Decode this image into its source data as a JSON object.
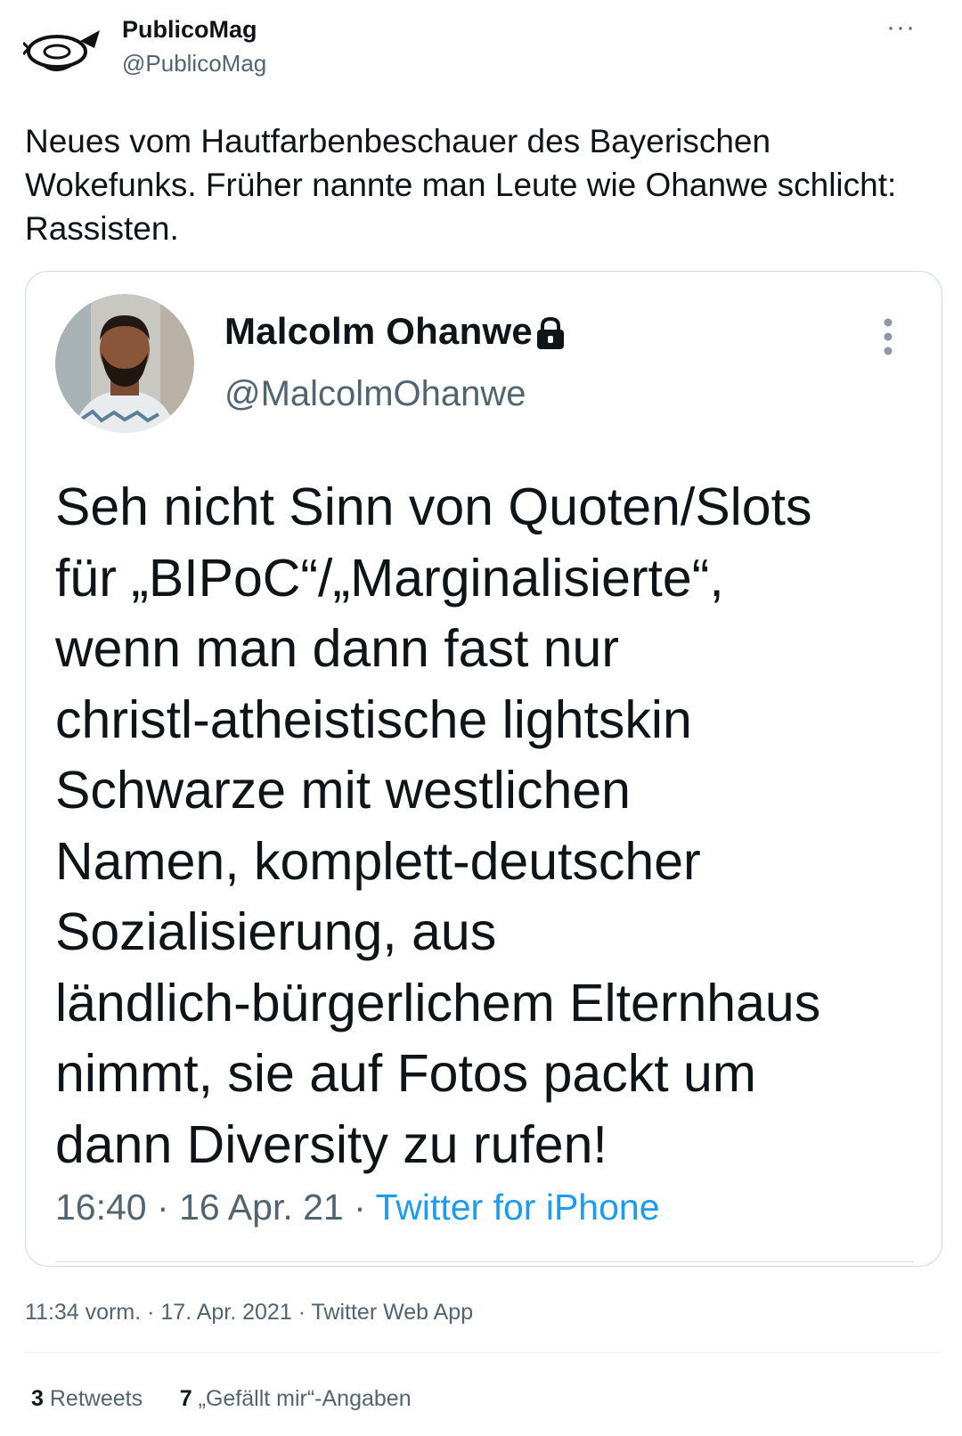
{
  "tweet": {
    "author_name": "PublicoMag",
    "author_handle": "@PublicoMag",
    "more_glyph": "···",
    "text": "Neues vom Hautfarbenbeschauer des Bayerischen Wokefunks. Früher nannte man Leute wie Ohanwe schlicht: Rassisten.",
    "time": "11:34 vorm.",
    "date": "17. Apr. 2021",
    "source": "Twitter Web App",
    "separator": "·"
  },
  "quoted": {
    "author_name": "Malcolm Ohanwe",
    "author_handle": "@MalcolmOhanwe",
    "icon": "lock-icon",
    "text": "Seh nicht Sinn von Quoten/Slots\nfür „BIPoC“/„Marginalisierte“,\nwenn man dann fast nur\nchristl-atheistische lightskin\nSchwarze mit westlichen\nNamen, komplett-deutscher\nSozialisierung, aus\nländlich-bürgerlichem Elternhaus\nnimmt, sie auf Fotos packt um\ndann Diversity zu rufen!",
    "time": "16:40",
    "date": "16 Apr. 21",
    "source": "Twitter for iPhone",
    "separator": "·"
  },
  "stats": {
    "retweets_count": "3",
    "retweets_label": "Retweets",
    "likes_count": "7",
    "likes_label": "„Gefällt mir“-Angaben"
  },
  "colors": {
    "text": "#0f1419",
    "secondary": "#536471",
    "link": "#1d9bf0",
    "border": "#cfd9de"
  }
}
